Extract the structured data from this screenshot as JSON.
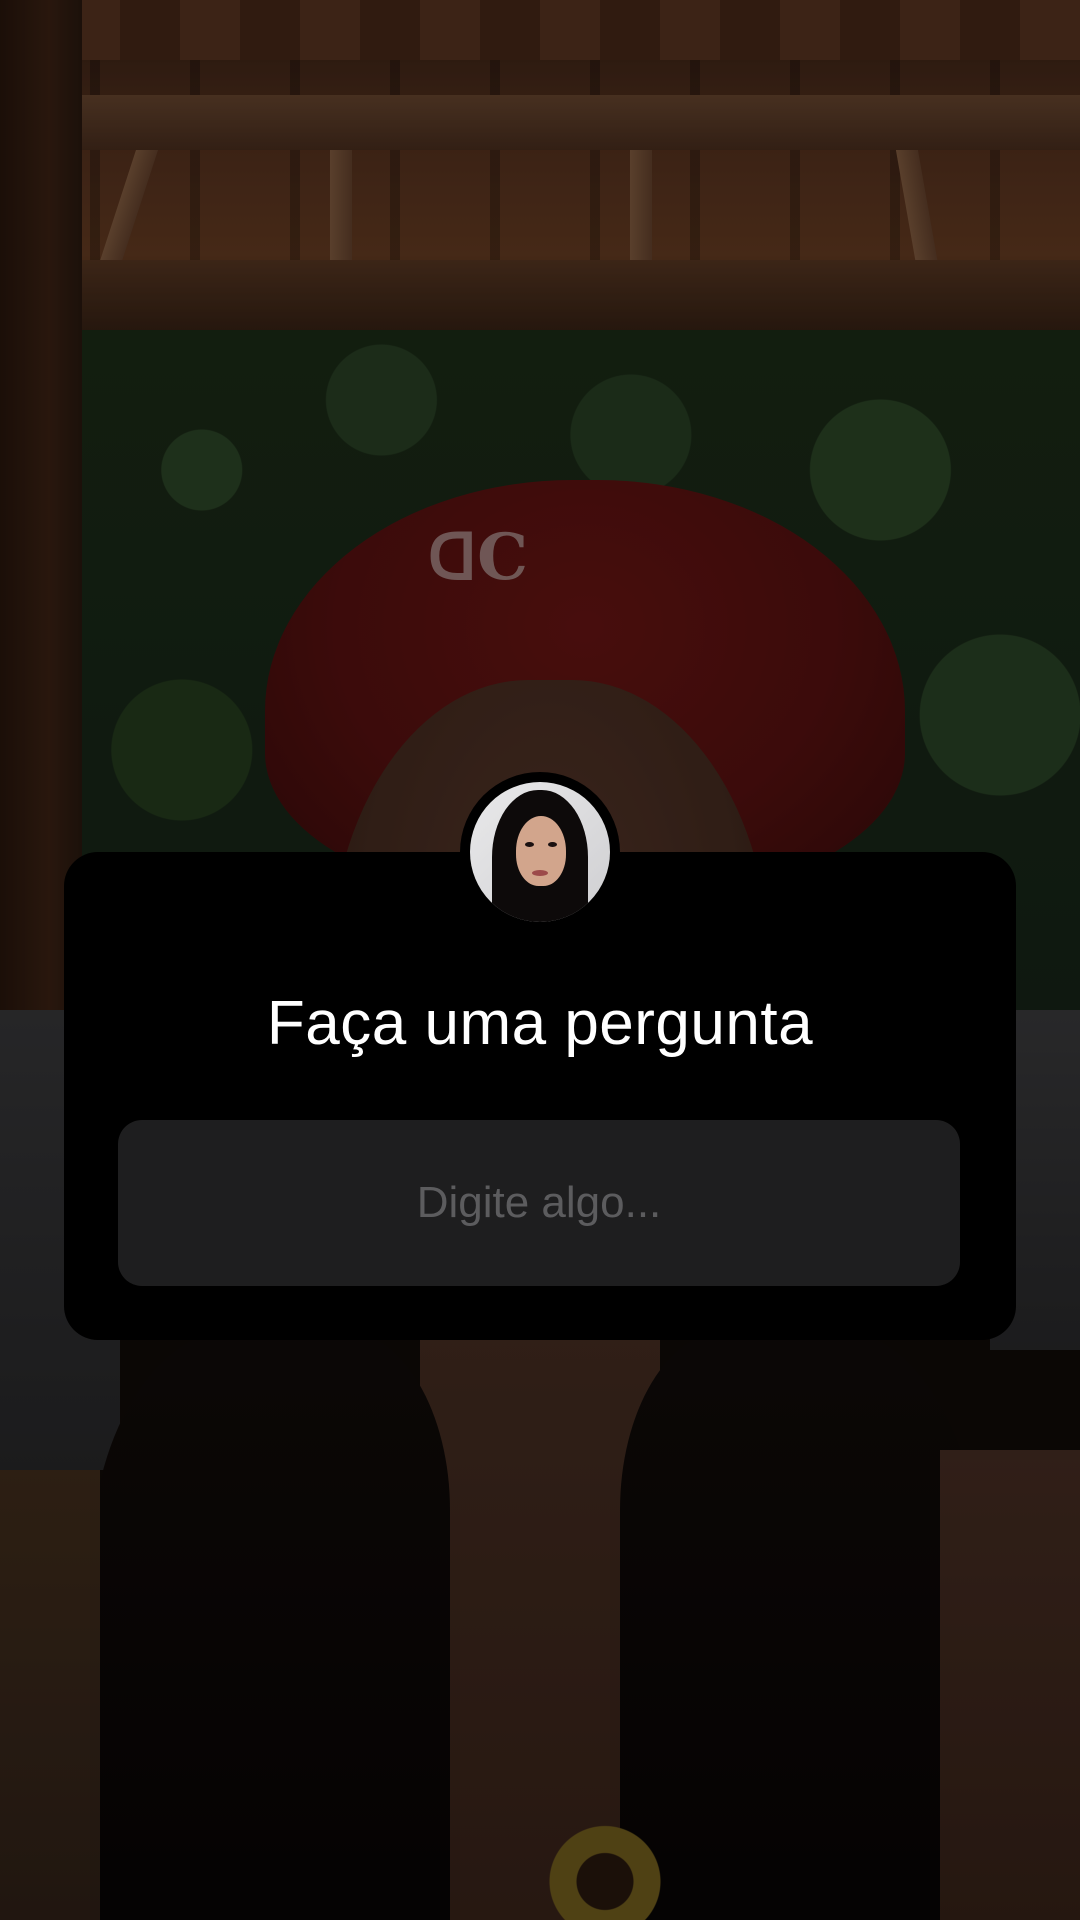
{
  "sticker": {
    "title": "Faça uma pergunta",
    "placeholder": "Digite algo..."
  },
  "colors": {
    "sticker_background": "#000000",
    "field_background": "#1e1e1f",
    "title_text": "#ffffff",
    "placeholder_text": "#5c5c5e"
  }
}
